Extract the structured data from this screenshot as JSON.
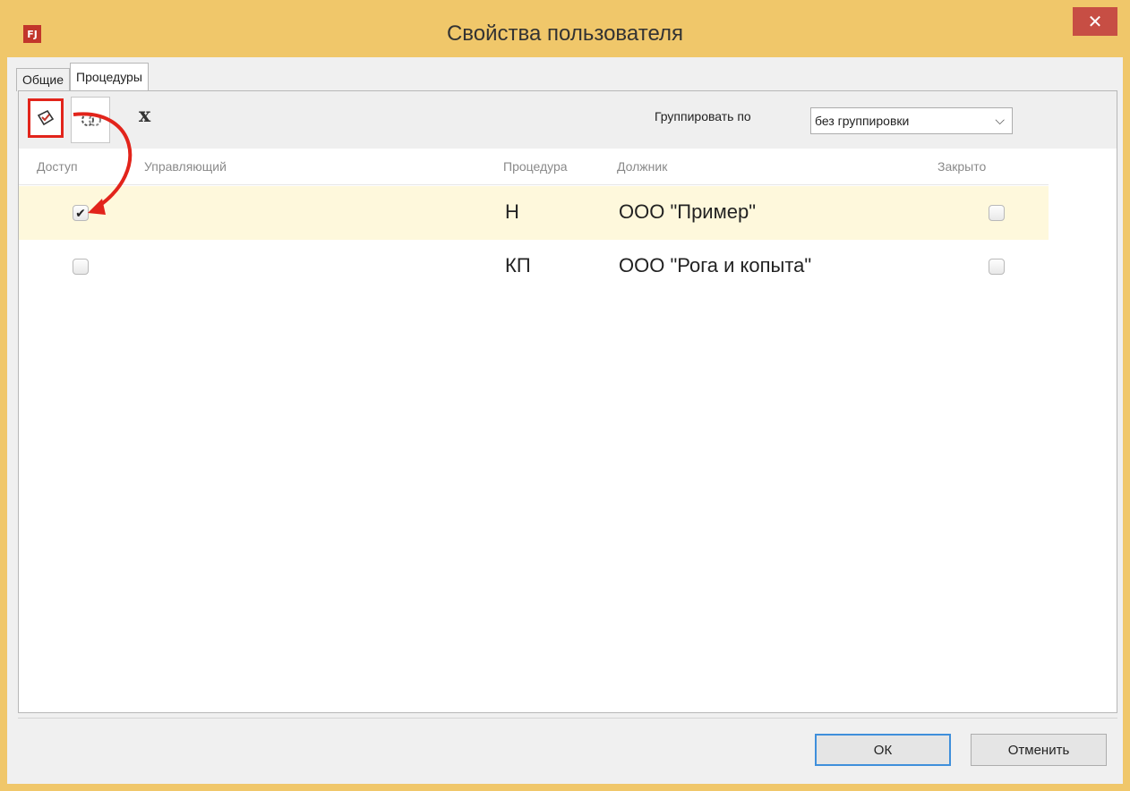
{
  "window": {
    "title": "Свойства пользователя",
    "app_icon_text": "FJ",
    "close_symbol": "✕"
  },
  "tabs": [
    {
      "label": "Общие",
      "active": false
    },
    {
      "label": "Процедуры",
      "active": true
    }
  ],
  "toolbar": {
    "access_button_icon": "access-grant-icon",
    "tools_button_icon": "wrench-gear-icon",
    "clear_label": "x",
    "group_by_label": "Группировать по",
    "group_by_value": "без группировки"
  },
  "columns": {
    "access": "Доступ",
    "manager": "Управляющий",
    "procedure": "Процедура",
    "debtor": "Должник",
    "closed": "Закрыто"
  },
  "rows": [
    {
      "access": true,
      "manager": "",
      "procedure": "Н",
      "debtor": "ООО \"Пример\"",
      "closed": false,
      "selected": true
    },
    {
      "access": false,
      "manager": "",
      "procedure": "КП",
      "debtor": "ООО \"Рога и копыта\"",
      "closed": false,
      "selected": false
    }
  ],
  "buttons": {
    "ok": "ОК",
    "cancel": "Отменить"
  },
  "colors": {
    "titlebar": "#f0c76a",
    "close": "#c74e44",
    "annotation": "#e2241b",
    "selected_row": "#fef8dc"
  }
}
